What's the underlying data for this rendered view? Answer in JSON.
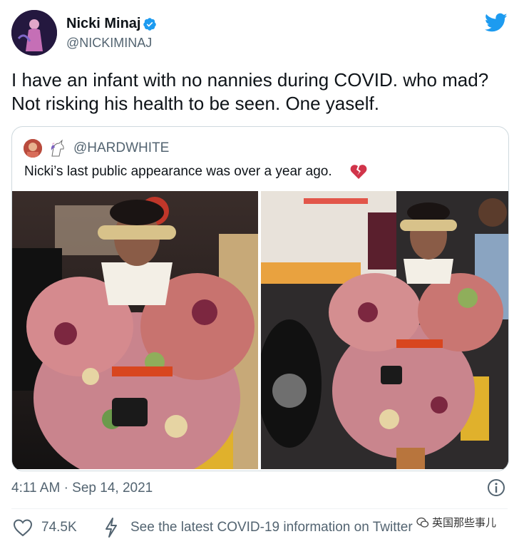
{
  "author": {
    "name": "Nicki Minaj",
    "handle": "@NICKIMINAJ"
  },
  "tweet": {
    "text": "I have an infant with no nannies during COVID. who mad?\nNot risking his health to be seen. One yaself."
  },
  "quoted": {
    "handle": "@HARDWHITE",
    "text": "Nicki’s last public appearance was over a year ago."
  },
  "footer": {
    "timestamp": "4:11 AM · Sep 14, 2021",
    "likes": "74.5K",
    "covid_link": "See the latest COVID-19 information on Twitter"
  },
  "watermark": {
    "text": "英国那些事儿"
  },
  "colors": {
    "twitter_blue": "#1d9bf0",
    "secondary_text": "#536471",
    "border": "#cfd9de"
  },
  "icons": [
    "verified-badge-icon",
    "twitter-bird-icon",
    "broken-heart-icon",
    "info-icon",
    "heart-icon",
    "lightning-bolt-icon"
  ]
}
